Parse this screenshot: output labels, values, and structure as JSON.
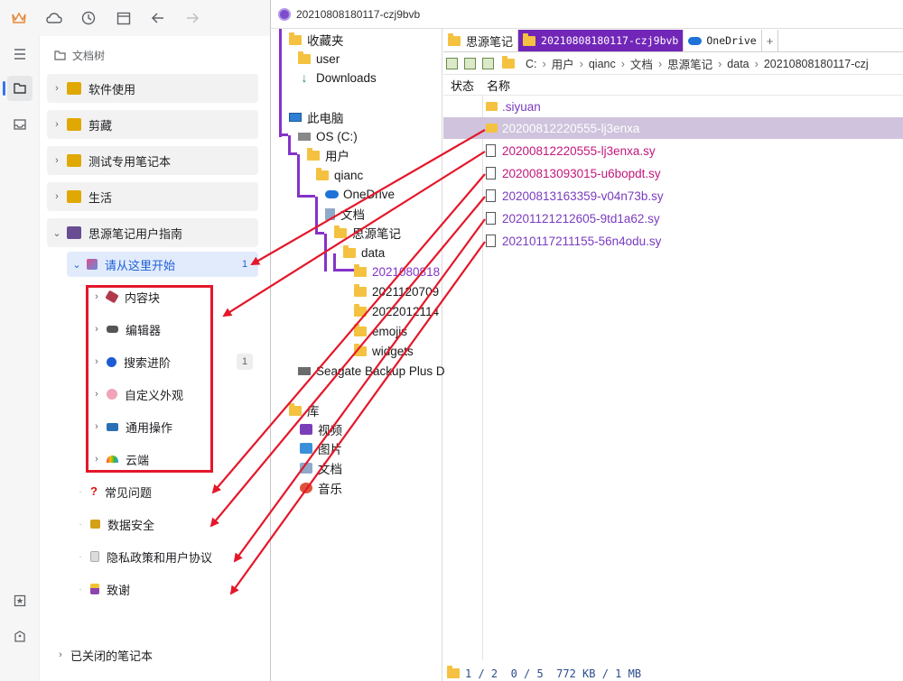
{
  "siyuan": {
    "tree_header": "文档树",
    "notebooks": [
      {
        "label": "软件使用",
        "icon_color": "#e0a800"
      },
      {
        "label": "剪藏",
        "icon_color": "#e0a800"
      },
      {
        "label": "测试专用笔记本",
        "icon_color": "#e0a800"
      },
      {
        "label": "生活",
        "icon_color": "#e0a800"
      },
      {
        "label": "思源笔记用户指南",
        "icon_color": "#6a4c93"
      }
    ],
    "start_doc": {
      "label": "请从这里开始",
      "count": "1"
    },
    "children": [
      {
        "label": "内容块",
        "count": ""
      },
      {
        "label": "编辑器",
        "count": ""
      },
      {
        "label": "搜索进阶",
        "count": "1"
      },
      {
        "label": "自定义外观",
        "count": ""
      },
      {
        "label": "通用操作",
        "count": ""
      },
      {
        "label": "云端",
        "count": ""
      }
    ],
    "other_docs": [
      {
        "label": "常见问题"
      },
      {
        "label": "数据安全"
      },
      {
        "label": "隐私政策和用户协议"
      },
      {
        "label": "致谢"
      }
    ],
    "closed_notebooks": "已关闭的笔记本",
    "accent": "#3575f0"
  },
  "explorer": {
    "window_title": "20210808180117-czj9bvb",
    "left_tree": {
      "favorites": "收藏夹",
      "user": "user",
      "downloads": "Downloads",
      "this_pc": "此电脑",
      "os_drive": "OS (C:)",
      "users": "用户",
      "qianc": "qianc",
      "onedrive": "OneDrive",
      "documents": "文档",
      "siyuan": "思源笔记",
      "data": "data",
      "sub_folders": [
        "2021080818",
        "2021120709",
        "2022012114",
        "emojis",
        "widgets"
      ],
      "seagate": "Seagate Backup Plus D",
      "library": "库",
      "libs": [
        "视频",
        "图片",
        "文档",
        "音乐"
      ]
    },
    "tabs": [
      "思源笔记",
      "20210808180117-czj9bvb",
      "OneDrive",
      "+"
    ],
    "address": [
      "C:",
      "用户",
      "qianc",
      "文档",
      "思源笔记",
      "data",
      "20210808180117-czj"
    ],
    "columns": {
      "status": "状态",
      "name": "名称"
    },
    "files": [
      {
        "name": ".siyuan",
        "type": "folder"
      },
      {
        "name": "20200812220555-lj3enxa",
        "type": "folder"
      },
      {
        "name": "20200812220555-lj3enxa.sy",
        "type": "file"
      },
      {
        "name": "20200813093015-u6bopdt.sy",
        "type": "file"
      },
      {
        "name": "20200813163359-v04n73b.sy",
        "type": "file"
      },
      {
        "name": "20201121212605-9td1a62.sy",
        "type": "file"
      },
      {
        "name": "20210117211155-56n4odu.sy",
        "type": "file"
      }
    ],
    "status_bar": "1 / 2  0 / 5  772 KB / 1 MB",
    "file_color": "#c2177b",
    "folder_text_color": "#7a3bbf",
    "tab_active_color": "#7226b8"
  }
}
